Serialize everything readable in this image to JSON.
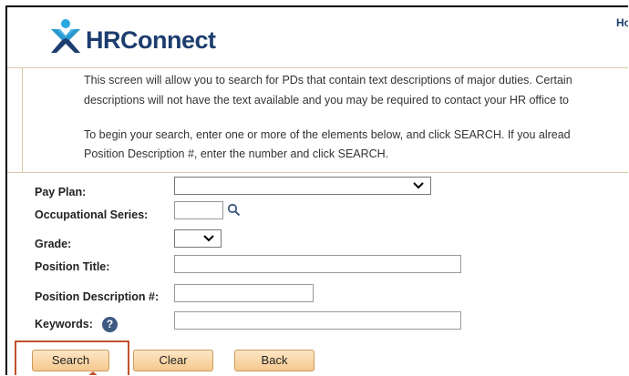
{
  "header": {
    "logo_text": "HRConnect",
    "home_link": "Ho"
  },
  "info": {
    "line1": "This screen will allow you to search for PDs that contain text descriptions of major duties. Certain",
    "line2": "descriptions will not have the text available and you may be required to contact your HR office to",
    "line3": "To begin your search, enter one or more of the elements below, and click SEARCH. If you alread",
    "line4": "Position Description #, enter the number and click SEARCH."
  },
  "form": {
    "pay_plan_label": "Pay Plan:",
    "pay_plan_value": "",
    "occ_series_label": "Occupational Series:",
    "occ_series_value": "",
    "grade_label": "Grade:",
    "grade_value": "",
    "position_title_label": "Position Title:",
    "position_title_value": "",
    "pd_number_label": "Position Description #:",
    "pd_number_value": "",
    "keywords_label": "Keywords:",
    "keywords_value": "",
    "help_glyph": "?"
  },
  "buttons": {
    "search": "Search",
    "clear": "Clear",
    "back": "Back"
  },
  "colors": {
    "brand_navy": "#1d3d6e",
    "brand_blue": "#2aa8e0",
    "button_fill": "#f6c88d",
    "highlight": "#c1522b"
  },
  "icons": {
    "logo": "x-person-logo",
    "lookup": "magnifier-icon",
    "help": "question-circle-icon",
    "dropdown": "chevron-down-icon"
  }
}
